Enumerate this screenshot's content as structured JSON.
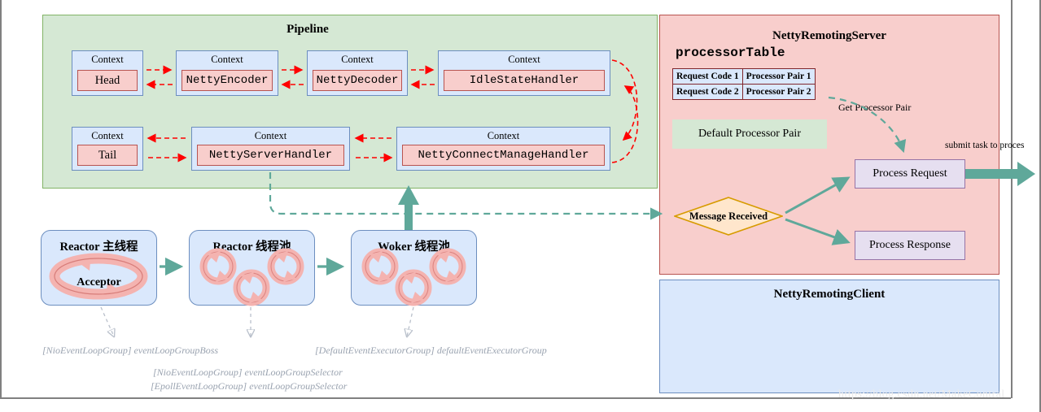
{
  "pipeline": {
    "title": "Pipeline",
    "context_label": "Context",
    "row1": [
      {
        "name": "Head",
        "mono": false
      },
      {
        "name": "NettyEncoder",
        "mono": true
      },
      {
        "name": "NettyDecoder",
        "mono": true
      },
      {
        "name": "IdleStateHandler",
        "mono": true
      }
    ],
    "row2": [
      {
        "name": "Tail",
        "mono": false
      },
      {
        "name": "NettyServerHandler",
        "mono": true
      },
      {
        "name": "NettyConnectManageHandler",
        "mono": true
      }
    ]
  },
  "reactors": [
    {
      "title": "Reactor 主线程",
      "inner_label": "Acceptor",
      "loops": 1
    },
    {
      "title": "Reactor 线程池",
      "inner_label": "",
      "loops": 3
    },
    {
      "title": "Woker 线程池",
      "inner_label": "",
      "loops": 3
    }
  ],
  "annotations": [
    "[NioEventLoopGroup] eventLoopGroupBoss",
    "[DefaultEventExecutorGroup] defaultEventExecutorGroup",
    "[NioEventLoopGroup] eventLoopGroupSelector",
    "[EpollEventLoopGroup] eventLoopGroupSelector"
  ],
  "server": {
    "title": "NettyRemotingServer",
    "processor_table_label": "processorTable",
    "table_rows": [
      [
        "Request Code 1",
        "Processor Pair 1"
      ],
      [
        "Request Code 2",
        "Processor Pair 2"
      ]
    ],
    "default_processor_pair": "Default Processor Pair",
    "get_processor_pair_label": "Get Processor Pair",
    "message_received": "Message Received",
    "process_request": "Process Request",
    "process_response": "Process Response",
    "submit_task_label": "submit task to proces"
  },
  "client": {
    "title": "NettyRemotingClient"
  },
  "watermark": "https://blog.csdn.net/MakeContral",
  "colors": {
    "green_panel_bg": "#d5e8d4",
    "green_panel_border": "#82b366",
    "blue_box_bg": "#dae8fc",
    "blue_box_border": "#6c8ebf",
    "red_box_bg": "#f8cecc",
    "red_box_border": "#b85450",
    "purple_box_bg": "#e6dff0",
    "purple_box_border": "#9673a6",
    "diamond_bg": "#ffe6cc",
    "diamond_border": "#d79b00",
    "teal_arrow": "#5fa89a",
    "red_arrow": "#ff0000",
    "annotation_text": "#9aa3b0"
  }
}
